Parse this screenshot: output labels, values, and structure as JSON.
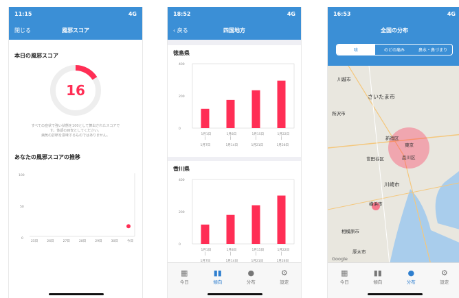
{
  "phone1": {
    "time": "11:15",
    "signal": "4G",
    "close_label": "閉じる",
    "title": "風邪スコア",
    "score_heading": "本日の風邪スコア",
    "score_value": "16",
    "score_fraction": 0.16,
    "note_line1": "すべての症状で強い状態を100として算出されたスコアで",
    "note_line2": "す。体調の目安としてください。",
    "note_line3": "病気の診断を意味するものではありません。",
    "trend_heading": "あなたの風邪スコアの推移",
    "y_ticks": [
      "100",
      "50",
      "0"
    ],
    "x_ticks": [
      "25日",
      "26日",
      "27日",
      "28日",
      "29日",
      "30日",
      "今日"
    ],
    "point_today": 16
  },
  "phone2": {
    "time": "18:52",
    "signal": "4G",
    "back_label": "戻る",
    "title": "四国地方",
    "charts": [
      {
        "title": "徳島県",
        "type": "bar",
        "y_ticks": [
          "400",
          "200",
          "0"
        ],
        "ylim": [
          0,
          400
        ],
        "categories_top": [
          "1月1日",
          "1月8日",
          "1月15日",
          "1月22日"
        ],
        "categories_bottom": [
          "1月7日",
          "1月14日",
          "1月21日",
          "1月28日"
        ],
        "values": [
          120,
          175,
          235,
          295
        ]
      },
      {
        "title": "香川県",
        "type": "bar",
        "y_ticks": [
          "400",
          "200",
          "0"
        ],
        "ylim": [
          0,
          400
        ],
        "categories_top": [
          "1月1日",
          "1月8日",
          "1月15日",
          "1月22日"
        ],
        "categories_bottom": [
          "1月7日",
          "1月14日",
          "1月21日",
          "1月28日"
        ],
        "values": [
          120,
          180,
          240,
          300
        ]
      }
    ]
  },
  "phone3": {
    "time": "16:53",
    "signal": "4G",
    "title": "全国の分布",
    "segments": [
      "咳",
      "のどの痛み",
      "鼻水・鼻づまり"
    ],
    "map_labels": [
      "川越市",
      "さいたま市",
      "所沢市",
      "東京",
      "新宿区",
      "世田谷区",
      "品川区",
      "川崎市",
      "横浜市",
      "相模原市",
      "厚木市"
    ],
    "google_label": "Google"
  },
  "tabs": [
    {
      "label": "今日",
      "icon": "calendar-icon"
    },
    {
      "label": "傾向",
      "icon": "bar-chart-icon"
    },
    {
      "label": "分布",
      "icon": "location-pin-icon"
    },
    {
      "label": "設定",
      "icon": "gear-icon"
    }
  ],
  "colors": {
    "primary": "#3b8fd6",
    "accent": "#ff2e55"
  }
}
